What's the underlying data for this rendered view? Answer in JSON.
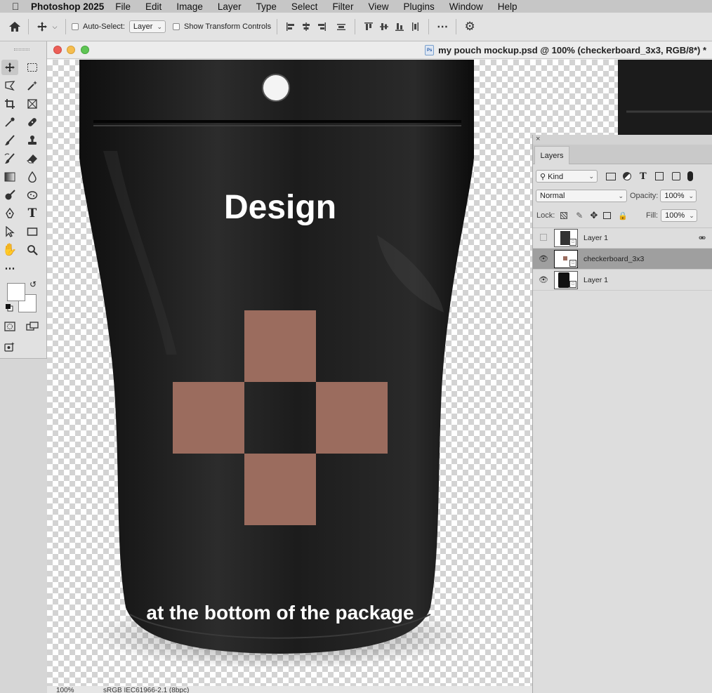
{
  "menubar": {
    "app_name": "Photoshop 2025",
    "items": [
      "File",
      "Edit",
      "Image",
      "Layer",
      "Type",
      "Select",
      "Filter",
      "View",
      "Plugins",
      "Window",
      "Help"
    ]
  },
  "options_bar": {
    "auto_select_label": "Auto-Select:",
    "auto_select_target": "Layer",
    "show_transform_label": "Show Transform Controls"
  },
  "document": {
    "title": "my pouch mockup.psd @ 100% (checkerboard_3x3, RGB/8*) *",
    "design_text": "Design",
    "bottom_text": "at the bottom of the package",
    "pattern_color": "#9b6c5e",
    "pouch_color": "#1a1a1a"
  },
  "status": {
    "zoom": "100%",
    "profile": "sRGB IEC61966-2.1 (8bpc)"
  },
  "layers_panel": {
    "tab_label": "Layers",
    "filter_kind": "Kind",
    "blend_mode": "Normal",
    "opacity_label": "Opacity:",
    "opacity_value": "100%",
    "lock_label": "Lock:",
    "fill_label": "Fill:",
    "fill_value": "100%",
    "layers": [
      {
        "name": "Layer 1",
        "visible": false,
        "selected": false
      },
      {
        "name": "checkerboard_3x3",
        "visible": true,
        "selected": true
      },
      {
        "name": "Layer 1",
        "visible": true,
        "selected": false
      }
    ]
  }
}
